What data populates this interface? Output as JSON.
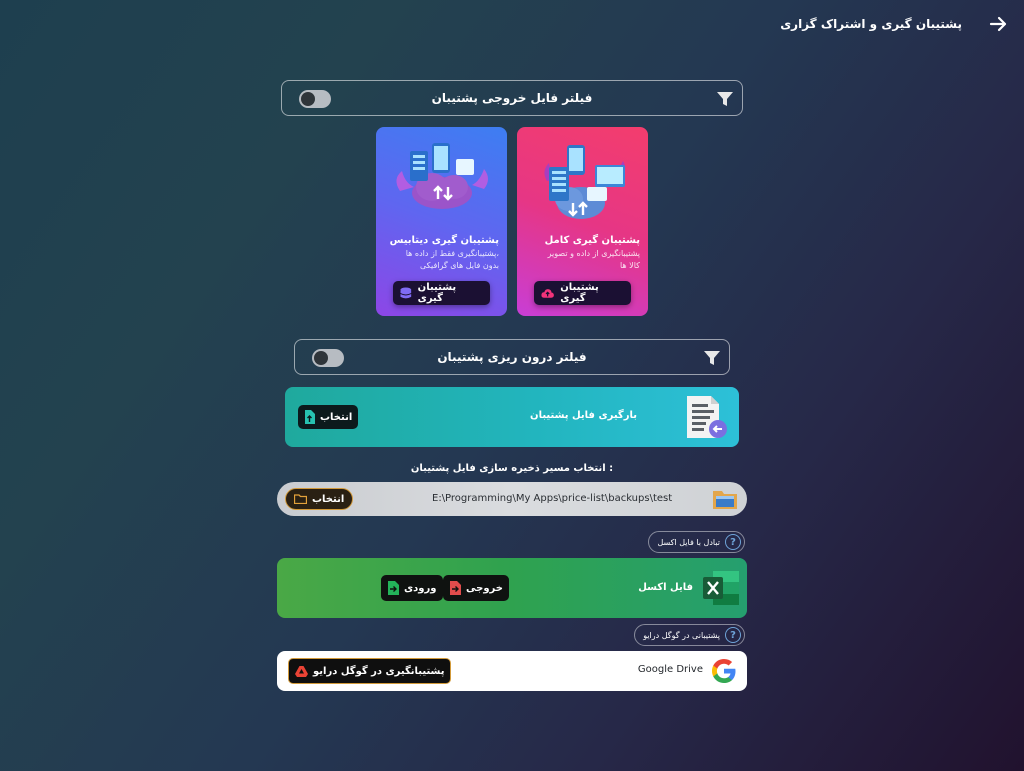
{
  "header": {
    "title": "پشتیبان گیری و اشتراک گزاری"
  },
  "output_filter": {
    "label": "فیلتر فایل خروجی پشتیبان"
  },
  "cards": [
    {
      "title": "پشتیبان گیری کامل",
      "desc_line1": "پشتیبانگیری از داده و تصویر",
      "desc_line2": "کالا ها",
      "button": "پشتیبان گیری"
    },
    {
      "title": "پشتیبان گیری دیتابیس",
      "desc_line1": "پشتیبانگیری فقط از داده ها،",
      "desc_line2": "بدون فایل های گرافیکی",
      "button": "پشتیبان گیری"
    }
  ],
  "import_filter": {
    "label": "فیلتر درون ریزی پشتیبان"
  },
  "load_backup": {
    "label": "بارگیری فایل پشتیبان",
    "button": "انتخاب"
  },
  "save_path": {
    "heading": "انتخاب مسیر ذخیره سازی فایل پشتیبان :",
    "path": "E:\\Programming\\My Apps\\price-list\\backups\\test",
    "button": "انتخاب"
  },
  "excel": {
    "help": "تبادل با فایل اکسل",
    "label": "فایل اکسل",
    "export_button": "خروجی",
    "import_button": "ورودی"
  },
  "drive": {
    "help": "پشتیبانی در گوگل درایو",
    "label": "Google Drive",
    "button": "پشتیبانگیری در گوگل درایو"
  },
  "colors": {
    "card_full": "#ee2f77",
    "card_db": "#6a55f0",
    "teal": "#23b4bf",
    "excel_green": "#2fa552",
    "accent_orange": "#e39a33"
  }
}
